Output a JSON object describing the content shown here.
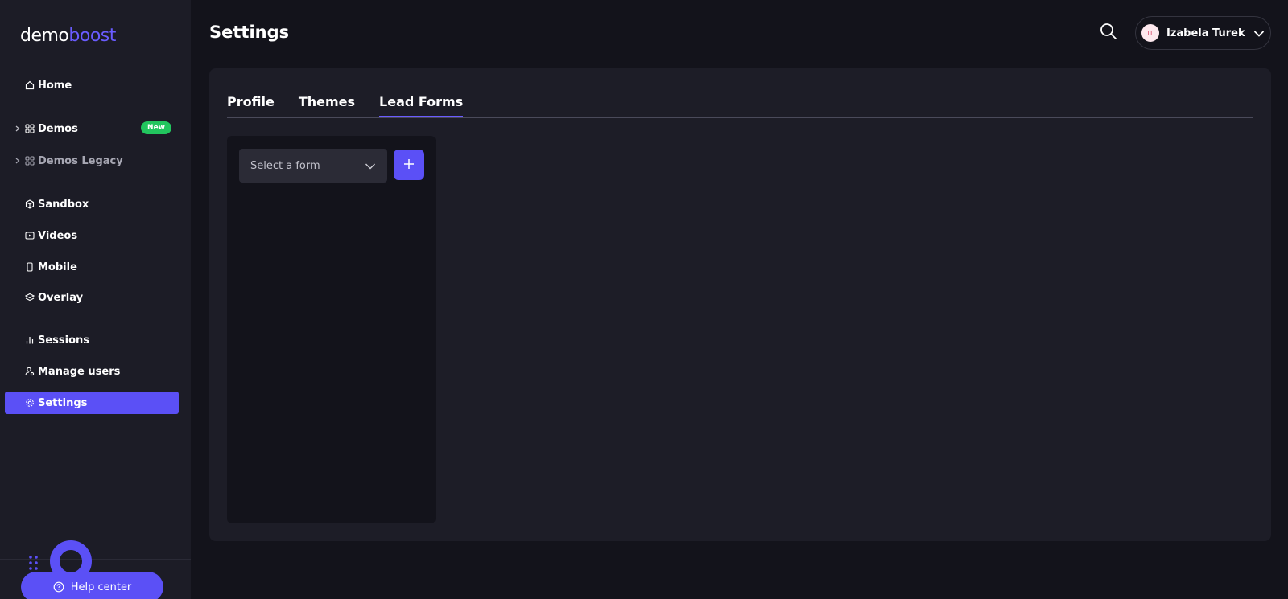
{
  "brand": {
    "part1": "demo",
    "part2": "boost"
  },
  "sidebar": {
    "items": [
      {
        "label": "Home",
        "icon": "home-icon"
      },
      {
        "label": "Demos",
        "icon": "grid-icon",
        "badge": "New"
      },
      {
        "label": "Demos Legacy",
        "icon": "grid-icon"
      },
      {
        "label": "Sandbox",
        "icon": "cube-icon"
      },
      {
        "label": "Videos",
        "icon": "video-icon"
      },
      {
        "label": "Mobile",
        "icon": "mobile-icon"
      },
      {
        "label": "Overlay",
        "icon": "layers-icon"
      },
      {
        "label": "Sessions",
        "icon": "bar-chart-icon"
      },
      {
        "label": "Manage users",
        "icon": "user-gear-icon"
      },
      {
        "label": "Settings",
        "icon": "gear-icon",
        "active": true
      }
    ],
    "help_label": "Help center"
  },
  "header": {
    "title": "Settings",
    "user": {
      "initials": "IT",
      "name": "Izabela Turek"
    }
  },
  "tabs": [
    {
      "label": "Profile"
    },
    {
      "label": "Themes"
    },
    {
      "label": "Lead Forms",
      "active": true
    }
  ],
  "lead_forms": {
    "select_placeholder": "Select a form"
  },
  "colors": {
    "accent": "#5b50f6",
    "badge_green": "#22c55e",
    "background": "#13131b",
    "panel": "#1d1d27"
  }
}
